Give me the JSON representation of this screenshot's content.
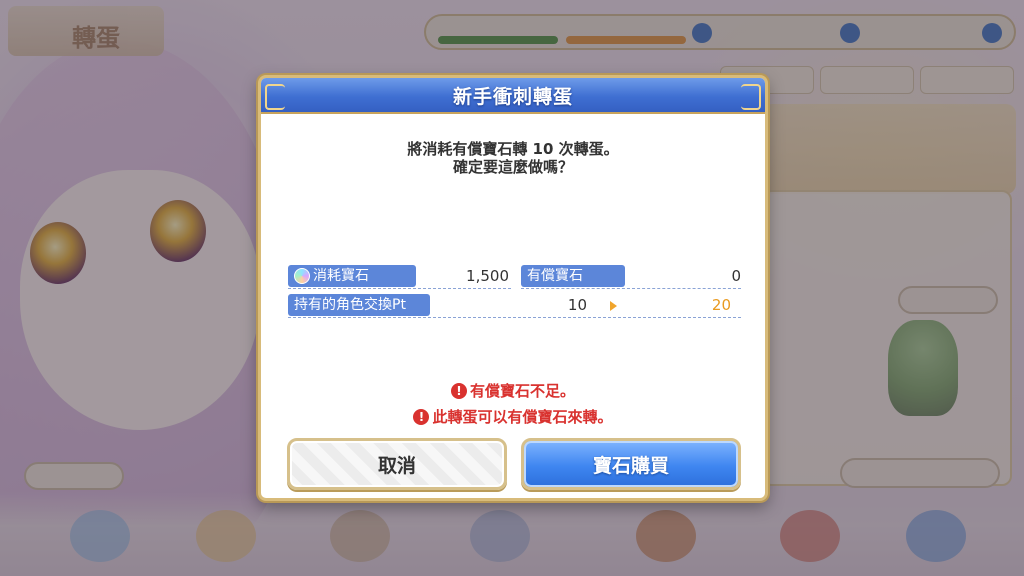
{
  "background": {
    "screen_title": "轉蛋"
  },
  "dialog": {
    "title": "新手衝刺轉蛋",
    "message_line1": "將消耗有償寶石轉 10 次轉蛋。",
    "message_line2": "確定要這麼做嗎？",
    "rows": [
      {
        "label": "消耗寶石",
        "value": "1,500",
        "icon": "gem-icon"
      },
      {
        "label": "有償寶石",
        "value": "0"
      },
      {
        "label": "持有的角色交換Pt",
        "value_from": "10",
        "value_to": "20"
      }
    ],
    "warnings": [
      "有償寶石不足。",
      "此轉蛋可以有償寶石來轉。"
    ],
    "buttons": {
      "cancel": "取消",
      "buy": "寶石購買"
    }
  },
  "colors": {
    "header_blue": "#3f6fd2",
    "label_blue": "#5c86d9",
    "warning_red": "#d9322f",
    "accent_orange": "#e99a1f",
    "frame_gold": "#d8bb7a"
  }
}
